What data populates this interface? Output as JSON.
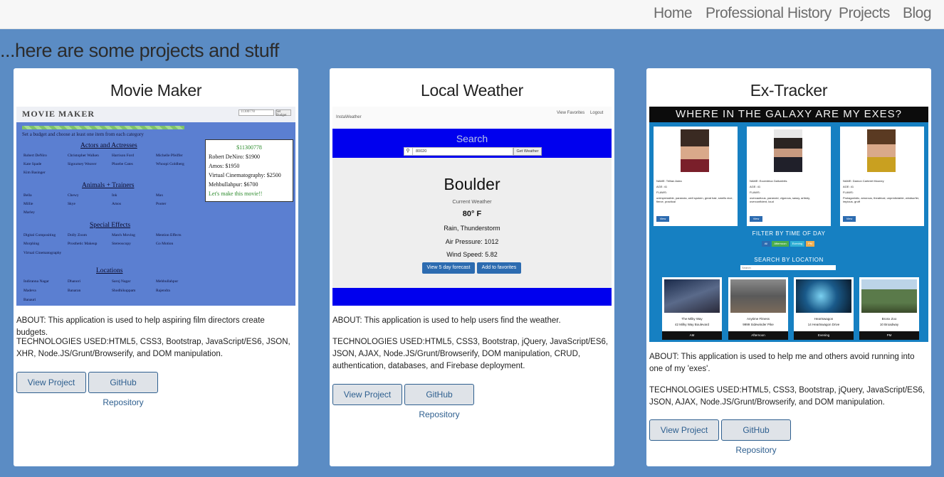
{
  "nav": {
    "items": [
      "Home",
      "Professional History",
      "Projects",
      "Blog"
    ]
  },
  "headline": "...here are some projects and stuff",
  "projects": [
    {
      "title": "Movie Maker",
      "about": "ABOUT: This application is used to help aspiring film directors create budgets.",
      "tech": "TECHNOLOGIES USED:HTML5, CSS3, Bootstrap, JavaScript/ES6, JSON, XHR, Node.JS/Grunt/Browserify, and DOM manipulation.",
      "view_label": "View Project",
      "repo_label": "GitHub Repository",
      "screenshot": {
        "logo": "MOVIE MAKER",
        "budget_input": "11300778",
        "budget_button": "Set Budget",
        "instruction": "Set a budget and choose at least one item from each category",
        "sections": [
          {
            "title": "Actors and Actresses",
            "options": [
              "Robert DeNiro",
              "Christopher Walken",
              "Harrison Ford",
              "Michelle Pfeiffer",
              "Kate Spade",
              "Sigourney Weaver",
              "Phoebe Cates",
              "Whoopi Goldberg",
              "Kim Basinger"
            ]
          },
          {
            "title": "Animals + Trainers",
            "options": [
              "Bella",
              "Chewy",
              "Ink",
              "Max",
              "Millie",
              "Skye",
              "Amos",
              "Pooter",
              "Marley"
            ]
          },
          {
            "title": "Special Effects",
            "options": [
              "Digital Compositing",
              "Dolly Zoom",
              "Match Moving",
              "Mention Effects",
              "Morphing",
              "Prosthetic Makeup",
              "Stereoscopy",
              "Go Motion",
              "Virtual Cinematography"
            ]
          },
          {
            "title": "Locations",
            "options": [
              "Indiranna Nagar",
              "Dhanori",
              "Saroj Nagar",
              "Mehbullahpur",
              "Madeva",
              "Banaran",
              "Shodhikuppam",
              "Rajendra",
              "Banauri"
            ]
          }
        ],
        "summary": [
          "$11300778",
          "Robert DeNiro: $1900",
          "Amos: $1950",
          "Virtual Cinematography: $2500",
          "Mehbullahpur: $6700",
          "Let's make this movie!!"
        ]
      }
    },
    {
      "title": "Local Weather",
      "about": "ABOUT: This application is used to help users find the weather.",
      "tech": "TECHNOLOGIES USED:HTML5, CSS3, Bootstrap, jQuery, JavaScript/ES6, JSON, AJAX, Node.JS/Grunt/Browserify, DOM manipulation, CRUD, authentication, databases, and Firebase deployment.",
      "view_label": "View Project",
      "repo_label": "GitHub Repository",
      "screenshot": {
        "brand": "InstaWeather",
        "nav_favorites": "View Favorites",
        "nav_logout": "Logout",
        "search_title": "Search",
        "zip": "80020",
        "get_weather": "Get Weather",
        "city": "Boulder",
        "current": "Current Weather",
        "temp": "80° F",
        "conditions": "Rain, Thunderstorm",
        "pressure": "Air Pressure: 1012",
        "wind": "Wind Speed: 5.82",
        "forecast_btn": "View 5 day forecast",
        "favorites_btn": "Add to favorites"
      }
    },
    {
      "title": "Ex-Tracker",
      "about": "ABOUT: This application is used to help me and others avoid running into one of my 'exes'.",
      "tech": "TECHNOLOGIES USED:HTML5, CSS3, Bootstrap, jQuery, JavaScript/ES6, JSON, AJAX, Node.JS/Grunt/Browserify, and DOM manipulation.",
      "view_label": "View Project",
      "repo_label": "GitHub Repository",
      "screenshot": {
        "header": "WHERE IN THE GALAXY ARE MY EXES?",
        "exes": [
          {
            "name": "NAME: Trillian Astra",
            "age": "AGE: 41",
            "flaws_label": "FLAWS:",
            "flaws": "unimpressible, paranoia, well spoken, great hair, smells nice, fierce, practical",
            "btn": "View"
          },
          {
            "name": "NAME: Eccentrica Gallumbits",
            "age": "AGE: 41",
            "flaws_label": "FLAWS:",
            "flaws": "overcautious, paranoid, vigorous, sassy, artistry, overconfident, loud",
            "btn": "View"
          },
          {
            "name": "NAME: Damon Carteret Mooney",
            "age": "AGE: 41",
            "flaws_label": "FLAWS:",
            "flaws": "Protagonistic, amorous, theatrical, unpredictable, windsurfer, impious, gruff",
            "btn": "View"
          }
        ],
        "filter_title": "FILTER BY TIME OF DAY",
        "times": [
          "All",
          "Afternoon",
          "Evening",
          "PM"
        ],
        "search_title": "SEARCH BY LOCATION",
        "search_placeholder": "Search",
        "locations": [
          {
            "name": "The Milky Way",
            "addr": "42 Milky Way Boulevard",
            "time": "AM"
          },
          {
            "name": "Anytime Fitness",
            "addr": "9999 Sidewinder Pike",
            "time": "Afternoon"
          },
          {
            "name": "Heartswagon",
            "addr": "14 Heartswagon Drive",
            "time": "Evening"
          },
          {
            "name": "Bronx Zoo",
            "addr": "10 Broadway",
            "time": "PM"
          }
        ]
      }
    }
  ],
  "colors": {
    "background": "#5b8cc4",
    "nav_bg": "#f7f7f7",
    "button_border": "#2e5f8f",
    "button_bg": "#dfe3e8"
  }
}
